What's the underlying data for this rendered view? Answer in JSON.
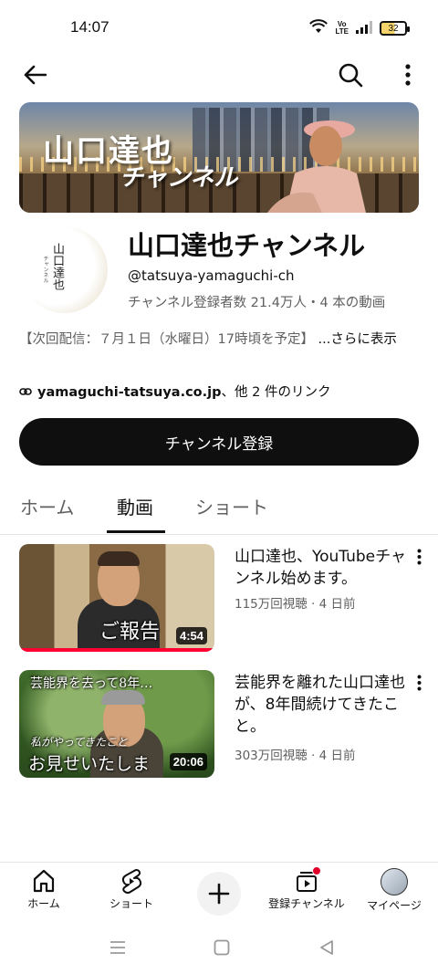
{
  "status_bar": {
    "time": "14:07",
    "volte_line1": "Vo",
    "volte_line2": "LTE",
    "battery": "32"
  },
  "top_bar": {
    "icons": [
      "back-arrow-icon",
      "search-icon",
      "more-vertical-icon"
    ]
  },
  "banner": {
    "title_line1": "山口達也",
    "title_line2": "チャンネル"
  },
  "avatar": {
    "text": "山口達也",
    "subtext": "チャンネル"
  },
  "channel": {
    "name": "山口達也チャンネル",
    "handle": "@tatsuya-yamaguchi-ch",
    "meta": "チャンネル登録者数 21.4万人・4 本の動画",
    "description": "【次回配信：７月１日（水曜日）17時頃を予定】",
    "description_more": " ...さらに表示",
    "link_url": "yamaguchi-tatsuya.co.jp",
    "link_rest": "、他 2 件のリンク",
    "subscribe_label": "チャンネル登録"
  },
  "tabs": [
    {
      "label": "ホーム",
      "active": false
    },
    {
      "label": "動画",
      "active": true
    },
    {
      "label": "ショート",
      "active": false
    }
  ],
  "videos": [
    {
      "title": "山口達也、YouTubeチャンネル始めます。",
      "meta": "115万回視聴 · 4 日前",
      "duration": "4:54",
      "thumb_caption": "ご報告"
    },
    {
      "title": "芸能界を離れた山口達也が、8年間続けてきたこと。",
      "meta": "303万回視聴 · 4 日前",
      "duration": "20:06",
      "thumb_caption_top": "芸能界を去って8年…",
      "thumb_caption_mid": "私がやってきたこと",
      "thumb_caption_bottom": "お見せいたしま"
    }
  ],
  "bottom_nav": [
    {
      "label": "ホーム",
      "icon": "home-icon"
    },
    {
      "label": "ショート",
      "icon": "shorts-icon"
    },
    {
      "label": "",
      "icon": "plus-icon"
    },
    {
      "label": "登録チャンネル",
      "icon": "subscriptions-icon"
    },
    {
      "label": "マイページ",
      "icon": "avatar"
    }
  ],
  "colors": {
    "accent": "#ff0033",
    "text_primary": "#0f0f0f",
    "text_secondary": "#606060"
  }
}
